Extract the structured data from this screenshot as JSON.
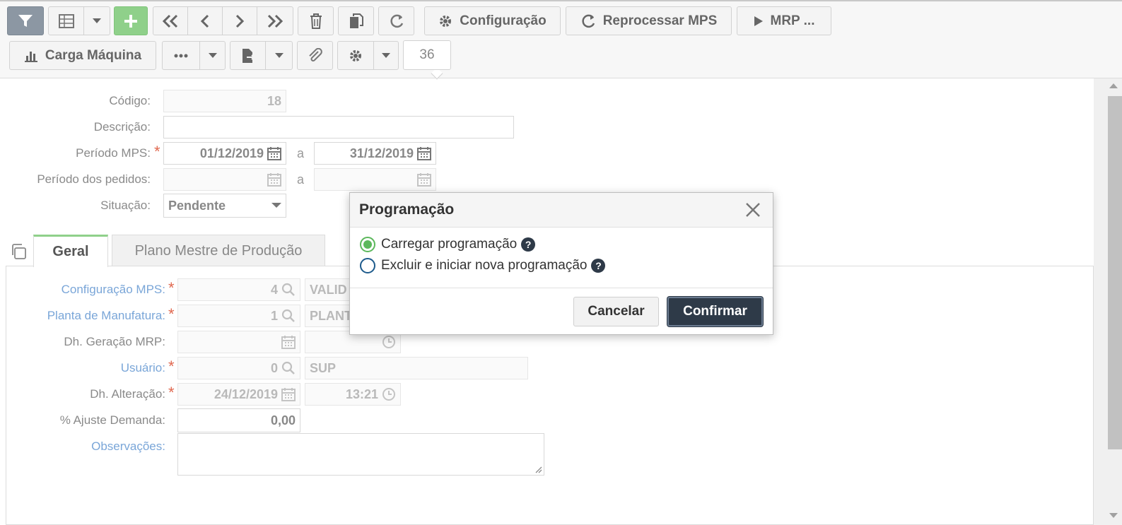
{
  "toolbar": {
    "configuracao_label": "Configuração",
    "reprocessar_label": "Reprocessar MPS",
    "mrp_label": "MRP ...",
    "carga_label": "Carga Máquina",
    "record_counter": "36"
  },
  "form": {
    "codigo_label": "Código:",
    "codigo_value": "18",
    "descricao_label": "Descrição:",
    "descricao_value": "",
    "periodo_mps_label": "Período MPS:",
    "periodo_mps_from": "01/12/2019",
    "periodo_mps_to": "31/12/2019",
    "range_sep": "a",
    "periodo_pedidos_label": "Período dos pedidos:",
    "periodo_pedidos_from": "",
    "periodo_pedidos_to": "",
    "situacao_label": "Situação:",
    "situacao_value": "Pendente"
  },
  "tabs": [
    {
      "label": "Geral"
    },
    {
      "label": "Plano Mestre de Produção"
    }
  ],
  "geral": {
    "config_mps_label": "Configuração MPS:",
    "config_mps_code": "4",
    "config_mps_desc": "VALID",
    "planta_label": "Planta de Manufatura:",
    "planta_code": "1",
    "planta_desc": "PLANT",
    "dh_geracao_label": "Dh. Geração MRP:",
    "usuario_label": "Usuário:",
    "usuario_code": "0",
    "usuario_desc": "SUP",
    "dh_alteracao_label": "Dh. Alteração:",
    "dh_alteracao_date": "24/12/2019",
    "dh_alteracao_time": "13:21",
    "ajuste_label": "% Ajuste Demanda:",
    "ajuste_value": "0,00",
    "observacoes_label": "Observações:"
  },
  "modal": {
    "title": "Programação",
    "option_load": "Carregar programação",
    "option_delete": "Excluir e iniciar nova programação",
    "cancel_label": "Cancelar",
    "confirm_label": "Confirmar"
  },
  "colors": {
    "accent_green": "#8fd08a",
    "link_blue": "#7aa6d8",
    "required_red": "#e0684f",
    "dark_button": "#2e3a48"
  },
  "icons": [
    "filter-icon",
    "grid-icon",
    "plus-icon",
    "first-icon",
    "prev-icon",
    "next-icon",
    "last-icon",
    "trash-icon",
    "copy-icon",
    "refresh-icon",
    "gear-icon",
    "play-icon",
    "bar-chart-icon",
    "more-icon",
    "export-icon",
    "paperclip-icon",
    "calendar-icon",
    "search-icon",
    "clock-icon",
    "close-icon",
    "help-icon"
  ]
}
